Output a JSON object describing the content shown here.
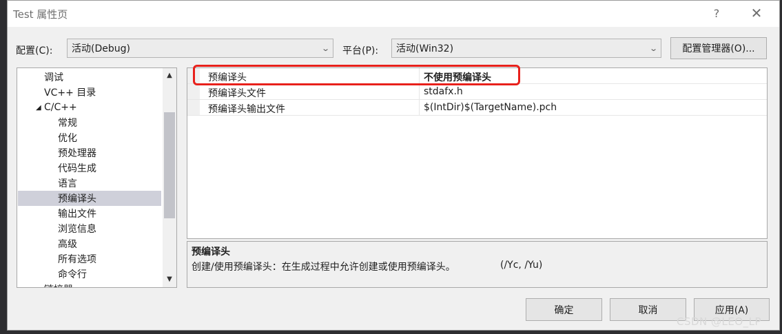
{
  "titlebar": {
    "title": "Test 属性页",
    "help": "?",
    "close": "✕"
  },
  "config": {
    "label": "配置(C):",
    "value": "活动(Debug)"
  },
  "platform": {
    "label": "平台(P):",
    "value": "活动(Win32)"
  },
  "config_manager_label": "配置管理器(O)...",
  "tree": {
    "items": [
      {
        "label": "调试"
      },
      {
        "label": "VC++ 目录"
      },
      {
        "label": "C/C++",
        "expander": "◢"
      },
      {
        "label": "常规"
      },
      {
        "label": "优化"
      },
      {
        "label": "预处理器"
      },
      {
        "label": "代码生成"
      },
      {
        "label": "语言"
      },
      {
        "label": "预编译头"
      },
      {
        "label": "输出文件"
      },
      {
        "label": "浏览信息"
      },
      {
        "label": "高级"
      },
      {
        "label": "所有选项"
      },
      {
        "label": "命令行"
      },
      {
        "label": "链接器",
        "expander": "▸"
      }
    ],
    "selected": "预编译头",
    "scroll_up": "▲",
    "scroll_down": "▼"
  },
  "properties": [
    {
      "name": "预编译头",
      "value": "不使用预编译头"
    },
    {
      "name": "预编译头文件",
      "value": "stdafx.h"
    },
    {
      "name": "预编译头输出文件",
      "value": "$(IntDir)$(TargetName).pch"
    }
  ],
  "description": {
    "title": "预编译头",
    "text": "创建/使用预编译头：在生成过程中允许创建或使用预编译头。",
    "options": "(/Yc, /Yu)"
  },
  "buttons": {
    "ok": "确定",
    "cancel": "取消",
    "apply": "应用(A)"
  },
  "watermark": "CSDN @LEO_LP",
  "colors": {
    "highlight_box": "#e8201b",
    "selected_item": "#cfd0da"
  }
}
